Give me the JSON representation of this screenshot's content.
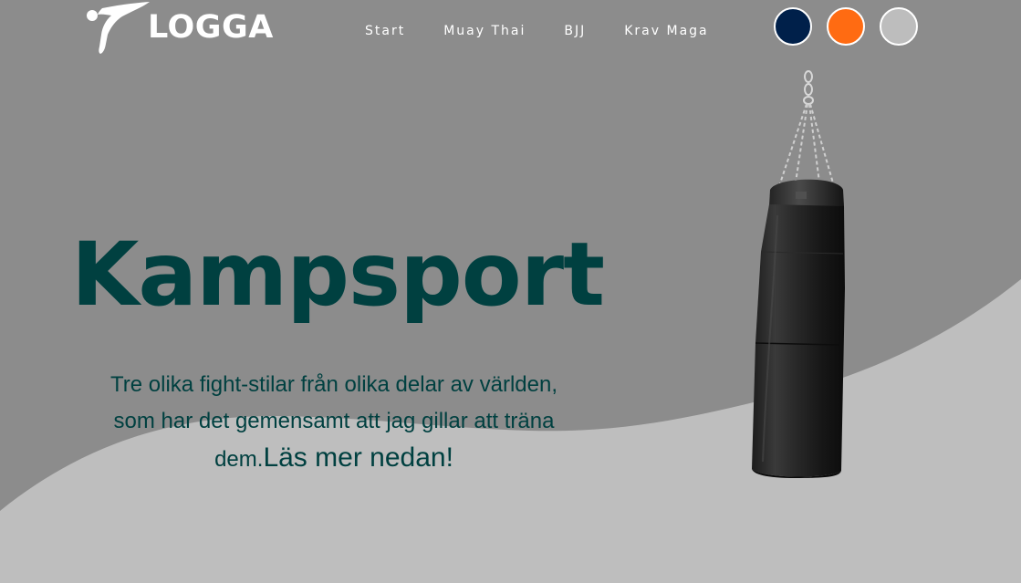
{
  "brand": {
    "logo_text": "LOGGA"
  },
  "nav": {
    "items": [
      {
        "label": "Start"
      },
      {
        "label": "Muay Thai"
      },
      {
        "label": "BJJ"
      },
      {
        "label": "Krav Maga"
      }
    ]
  },
  "theme_swatches": [
    {
      "color": "#00204a"
    },
    {
      "color": "#ff6b12"
    },
    {
      "color": "#bdbdbd"
    }
  ],
  "hero": {
    "title": "Kampsport",
    "description": "Tre olika fight-stilar från olika delar av världen, som har det gemensamt att jag gillar att träna dem.",
    "cta": "Läs mer nedan!"
  },
  "colors": {
    "background_dark": "#8c8c8c",
    "background_light": "#bebebe",
    "accent_text": "#004040",
    "nav_text": "#ffffff"
  },
  "icons": {
    "logo_mark": "kicking-figure-icon",
    "hero_image": "punching-bag-icon"
  }
}
